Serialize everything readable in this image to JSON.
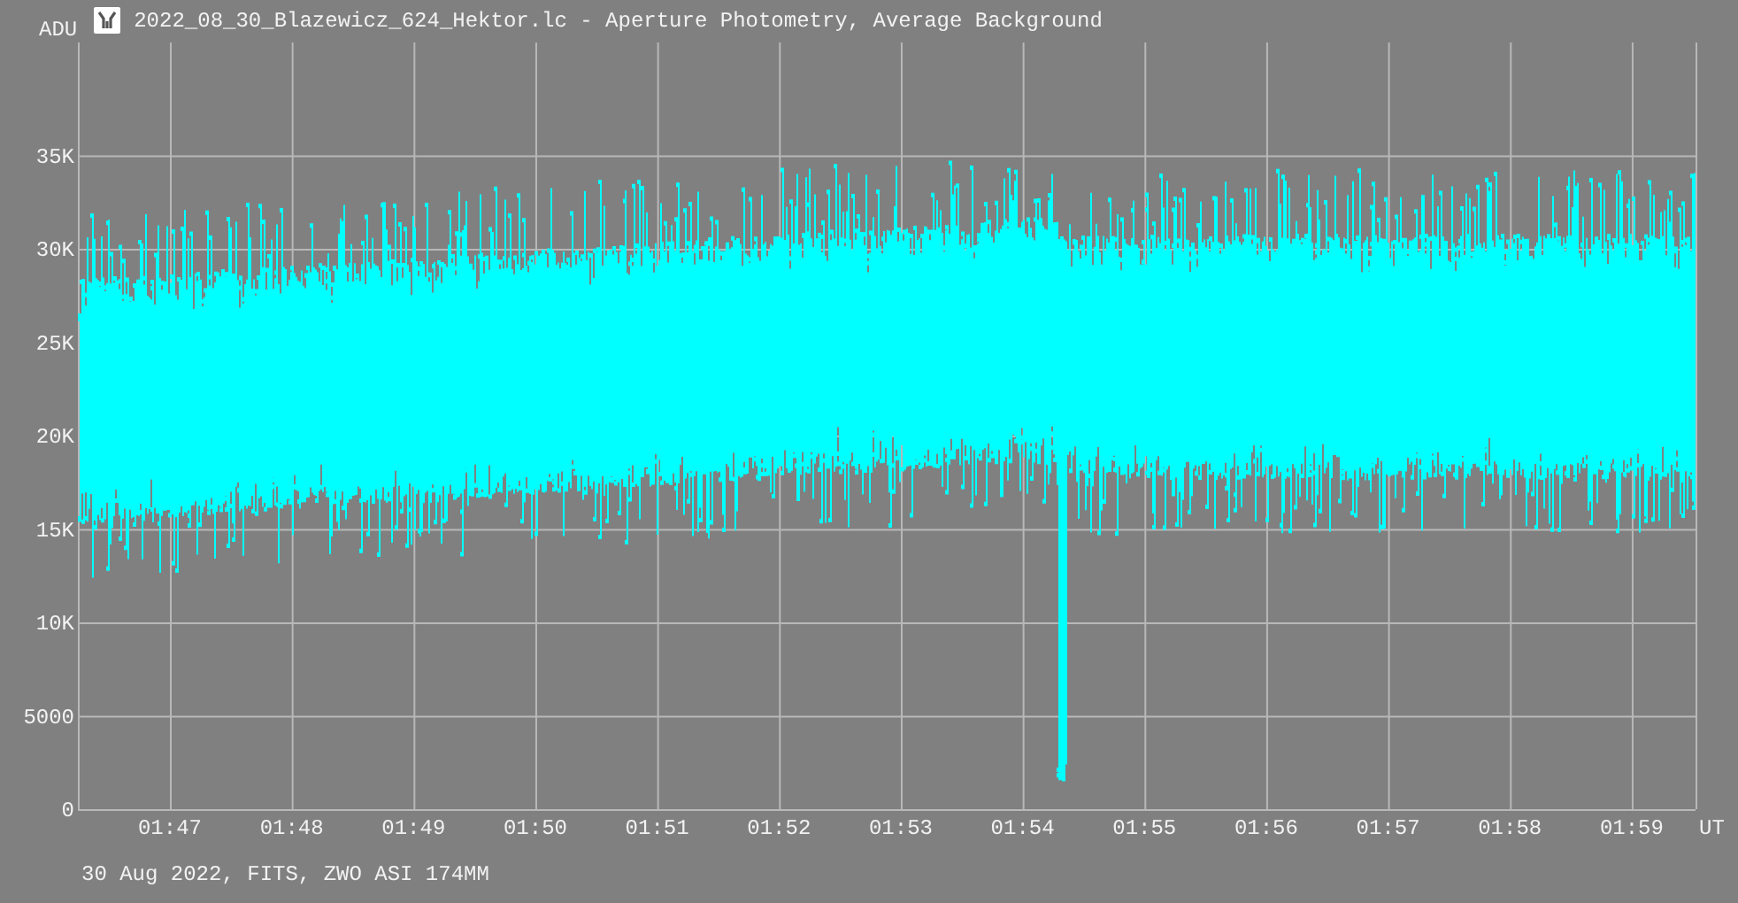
{
  "title_bar": {
    "title": "2022_08_30_Blazewicz_624_Hektor.lc - Aperture Photometry, Average Background"
  },
  "plot": {
    "y_unit": "ADU",
    "x_unit": "UT",
    "y_tick_labels": [
      "35K",
      "30K",
      "25K",
      "20K",
      "15K",
      "10K",
      "5000",
      "0"
    ],
    "x_tick_labels": [
      "01:47",
      "01:48",
      "01:49",
      "01:50",
      "01:51",
      "01:52",
      "01:53",
      "01:54",
      "01:55",
      "01:56",
      "01:57",
      "01:58",
      "01:59"
    ]
  },
  "footer": {
    "text": "30 Aug 2022, FITS, ZWO ASI 174MM"
  }
}
